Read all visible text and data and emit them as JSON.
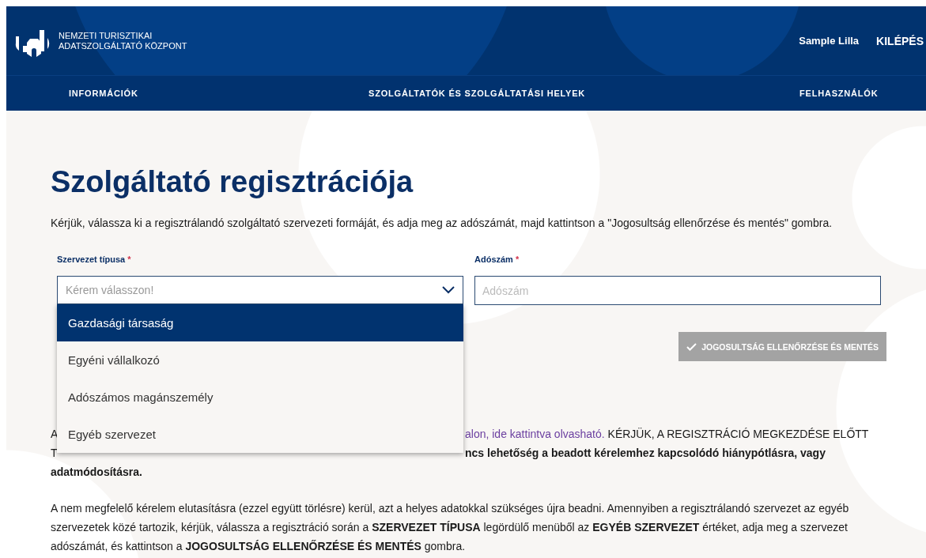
{
  "header": {
    "org_name": [
      "NEMZETI TURISZTIKAI",
      "ADATSZOLGÁLTATÓ KÖZPONT"
    ],
    "user_name": "Sample Lilla",
    "logout": "KILÉPÉS"
  },
  "nav": {
    "items": [
      {
        "label": "INFORMÁCIÓK"
      },
      {
        "label": "SZOLGÁLTATÓK ÉS SZOLGÁLTATÁSI HELYEK"
      },
      {
        "label": "FELHASZNÁLÓK"
      }
    ]
  },
  "page": {
    "title": "Szolgáltató regisztrációja",
    "intro": "Kérjük, válassza ki a regisztrálandó szolgáltató szervezeti formáját, és adja meg az adószámát, majd kattintson a \"Jogosultság ellenőrzése és mentés\" gombra."
  },
  "form": {
    "org_type": {
      "label": "Szervezet típusa",
      "required": "*",
      "placeholder": "Kérem válasszon!",
      "expanded": true,
      "options": [
        {
          "label": "Gazdasági társaság",
          "selected": true
        },
        {
          "label": "Egyéni vállalkozó",
          "selected": false
        },
        {
          "label": "Adószámos magánszemély",
          "selected": false
        },
        {
          "label": "Egyéb szervezet",
          "selected": false
        }
      ]
    },
    "tax_number": {
      "label": "Adószám",
      "required": "*",
      "placeholder": "Adószám"
    },
    "submit": {
      "label": "JOGOSULTSÁG ELLENŐRZÉSE ÉS MENTÉS",
      "disabled": true
    }
  },
  "info": {
    "line_1": {
      "start": "A",
      "link": "alon, ide kattintva olvasható.",
      "end": "KÉRJÜK, A REGISZTRÁCIÓ MEGKEZDÉSE ELŐTT"
    },
    "line_2": {
      "start": "T",
      "end": "ncs lehetőség a beadott kérelemhez kapcsolódó hiánypótlásra, vagy"
    },
    "line_3": "adatmódosításra.",
    "paragraph_2": "A nem megfelelő kérelem elutasításra (ezzel együtt törlésre) kerül, azt a helyes adatokkal szükséges újra beadni. Amennyiben a regisztrálandó szervezet az egyéb szervezetek közé tartozik, kérjük, válassza a regisztráció során a **SZERVEZET TÍPUSA** legördülő menüből az **EGYÉB SZERVEZET** értéket, adja meg a szervezet adószámát, és kattintson a **JOGOSULTSÁG ELLENŐRZÉSE ÉS MENTÉS** gombra."
  }
}
